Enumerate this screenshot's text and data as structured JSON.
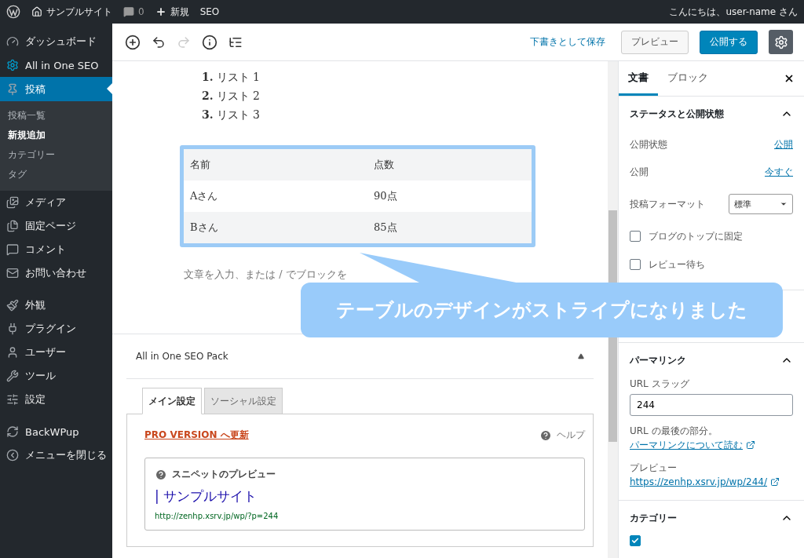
{
  "admin_bar": {
    "site": "サンプルサイト",
    "comments": "0",
    "new": "新規",
    "seo": "SEO",
    "greeting": "こんにちは、user-name さん"
  },
  "sidebar": {
    "groups": [
      {
        "items": [
          {
            "label": "ダッシュボード",
            "selected": false
          },
          {
            "label": "All in One SEO",
            "selected": false
          },
          {
            "label": "投稿",
            "selected": true,
            "children": [
              {
                "label": "投稿一覧",
                "selected": false
              },
              {
                "label": "新規追加",
                "selected": true
              },
              {
                "label": "カテゴリー",
                "selected": false
              },
              {
                "label": "タグ",
                "selected": false
              }
            ]
          },
          {
            "label": "メディア",
            "selected": false
          },
          {
            "label": "固定ページ",
            "selected": false
          },
          {
            "label": "コメント",
            "selected": false
          },
          {
            "label": "お問い合わせ",
            "selected": false
          }
        ]
      },
      {
        "items": [
          {
            "label": "外観",
            "selected": false
          },
          {
            "label": "プラグイン",
            "selected": false
          },
          {
            "label": "ユーザー",
            "selected": false
          },
          {
            "label": "ツール",
            "selected": false
          },
          {
            "label": "設定",
            "selected": false
          }
        ]
      },
      {
        "items": [
          {
            "label": "BackWPup",
            "selected": false
          },
          {
            "label": "メニューを閉じる",
            "selected": false
          }
        ]
      }
    ]
  },
  "toolbar": {
    "save_draft": "下書きとして保存",
    "preview": "プレビュー",
    "publish": "公開する"
  },
  "content": {
    "list": [
      {
        "number": "1.",
        "text": "リスト 1"
      },
      {
        "number": "2.",
        "text": "リスト 2"
      },
      {
        "number": "3.",
        "text": "リスト 3"
      }
    ],
    "table": {
      "striped": true,
      "columns": [
        "名前",
        "点数"
      ],
      "rows": [
        [
          "Aさん",
          "90点"
        ],
        [
          "Bさん",
          "85点"
        ]
      ]
    },
    "placeholder": "文章を入力、または / でブロックを"
  },
  "callout": "テーブルのデザインがストライプになりました",
  "seo_pack": {
    "title": "All in One SEO Pack",
    "expanded": true,
    "tabs": [
      {
        "label": "メイン設定",
        "selected": true
      },
      {
        "label": "ソーシャル設定",
        "selected": false
      }
    ],
    "pro_link": "PRO VERSION へ更新",
    "help": "ヘルプ",
    "snippet": {
      "heading": "スニペットのプレビュー",
      "title": "| サンプルサイト",
      "url": "http://zenhp.xsrv.jp/wp/?p=244"
    }
  },
  "settings": {
    "tabs": [
      {
        "label": "文書",
        "selected": true
      },
      {
        "label": "ブロック",
        "selected": false
      }
    ],
    "status": {
      "title": "ステータスと公開状態",
      "expanded": true,
      "rows": [
        {
          "label": "公開状態",
          "value": "公開"
        },
        {
          "label": "公開",
          "value": "今すぐ"
        }
      ],
      "format": {
        "label": "投稿フォーマット",
        "value": "標準"
      },
      "checks": [
        {
          "label": "ブログのトップに固定",
          "checked": false
        },
        {
          "label": "レビュー待ち",
          "checked": false
        }
      ]
    },
    "permalink": {
      "title": "パーマリンク",
      "expanded": true,
      "slug_label": "URL スラッグ",
      "slug": "244",
      "help_text": "URL の最後の部分。",
      "help_link": "パーマリンクについて読む",
      "preview_label": "プレビュー",
      "preview_link": "https://zenhp.xsrv.jp/wp/244/"
    },
    "category": {
      "title": "カテゴリー",
      "expanded": true,
      "items": [
        {
          "checked": true
        }
      ]
    }
  }
}
